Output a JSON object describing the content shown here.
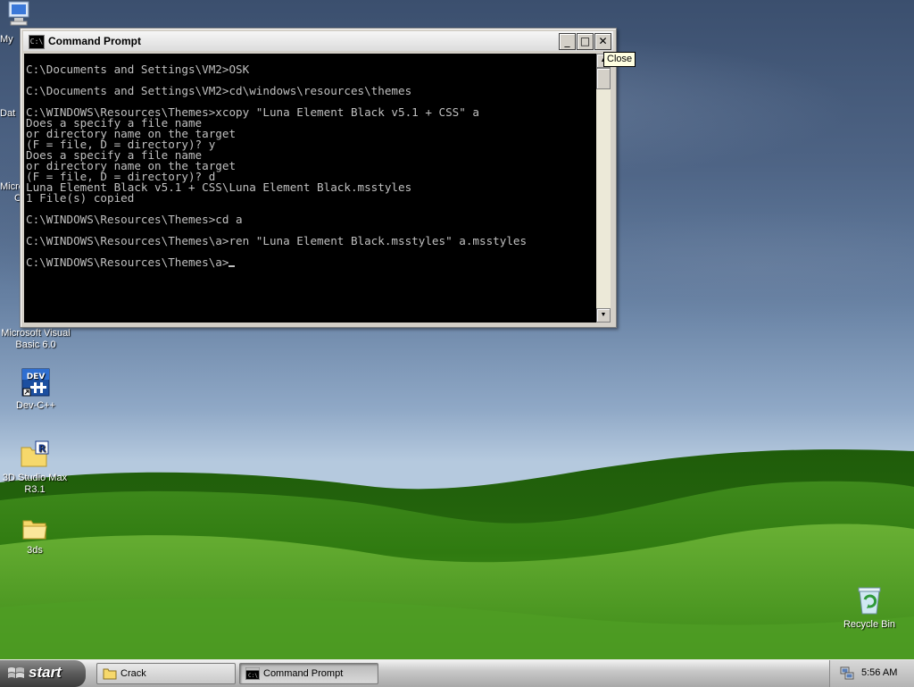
{
  "desktop": {
    "icons": [
      {
        "label": "My"
      },
      {
        "label": "Dat"
      },
      {
        "label": "Micro"
      },
      {
        "label": "C"
      },
      {
        "label": "Microsoft Visual Basic 6.0"
      },
      {
        "label": "Dev-C++"
      },
      {
        "label": "3D Studio Max R3.1"
      },
      {
        "label": "3ds"
      },
      {
        "label": "Recycle Bin"
      }
    ]
  },
  "window": {
    "title": "Command Prompt",
    "minimize_glyph": "_",
    "maximize_glyph": "□",
    "close_glyph": "✕",
    "close_tooltip": "Close",
    "icon_text": "C:\\",
    "console_lines": [
      "",
      "C:\\Documents and Settings\\VM2>OSK",
      "",
      "C:\\Documents and Settings\\VM2>cd\\windows\\resources\\themes",
      "",
      "C:\\WINDOWS\\Resources\\Themes>xcopy \"Luna Element Black v5.1 + CSS\" a",
      "Does a specify a file name",
      "or directory name on the target",
      "(F = file, D = directory)? y",
      "Does a specify a file name",
      "or directory name on the target",
      "(F = file, D = directory)? d",
      "Luna Element Black v5.1 + CSS\\Luna Element Black.msstyles",
      "1 File(s) copied",
      "",
      "C:\\WINDOWS\\Resources\\Themes>cd a",
      "",
      "C:\\WINDOWS\\Resources\\Themes\\a>ren \"Luna Element Black.msstyles\" a.msstyles",
      "",
      "C:\\WINDOWS\\Resources\\Themes\\a>"
    ]
  },
  "taskbar": {
    "start_label": "start",
    "buttons": [
      {
        "label": "Crack",
        "active": false
      },
      {
        "label": "Command Prompt",
        "active": true
      }
    ],
    "clock": "5:56 AM"
  },
  "colors": {
    "console_bg": "#000000",
    "console_fg": "#c0c0c0",
    "tooltip_bg": "#ffffe1"
  }
}
